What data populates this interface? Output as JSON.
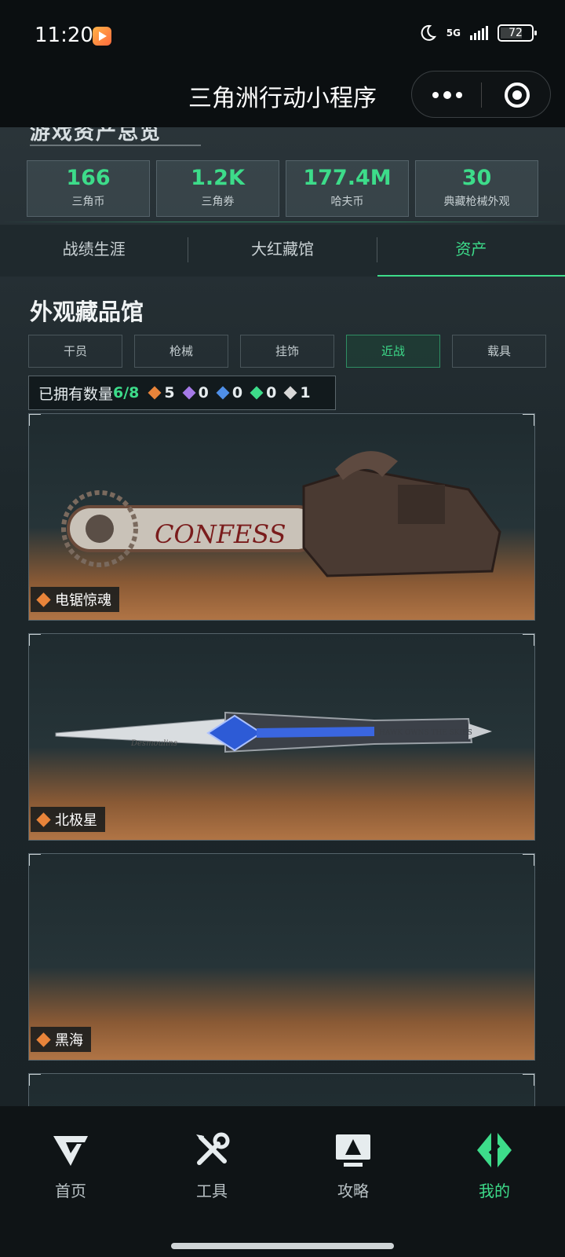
{
  "status_bar": {
    "time": "11:20",
    "network": "5G",
    "battery": "72",
    "battery_level": 72
  },
  "title_bar": {
    "title": "三角洲行动小程序"
  },
  "overview": {
    "title": "游戏资产总览",
    "stats": [
      {
        "value": "166",
        "label": "三角币"
      },
      {
        "value": "1.2K",
        "label": "三角券"
      },
      {
        "value": "177.4M",
        "label": "哈夫币"
      },
      {
        "value": "30",
        "label": "典藏枪械外观"
      }
    ]
  },
  "tabs": [
    {
      "label": "战绩生涯",
      "active": false
    },
    {
      "label": "大红藏馆",
      "active": false
    },
    {
      "label": "资产",
      "active": true
    }
  ],
  "collection": {
    "title": "外观藏品馆",
    "filters": [
      {
        "label": "干员",
        "active": false
      },
      {
        "label": "枪械",
        "active": false
      },
      {
        "label": "挂饰",
        "active": false
      },
      {
        "label": "近战",
        "active": true
      },
      {
        "label": "载具",
        "active": false
      }
    ],
    "owned_label": "已拥有数量",
    "owned_count": "6/8",
    "rarity_counts": [
      {
        "color": "#e9843a",
        "count": "5",
        "icon": "orange-gem-icon"
      },
      {
        "color": "#a57ae8",
        "count": "0",
        "icon": "purple-gem-icon"
      },
      {
        "color": "#4f8fe8",
        "count": "0",
        "icon": "blue-gem-icon"
      },
      {
        "color": "#3ddc8a",
        "count": "0",
        "icon": "green-gem-icon"
      },
      {
        "color": "#d8d8d8",
        "count": "1",
        "icon": "white-gem-icon"
      }
    ],
    "items": [
      {
        "name": "电锯惊魂",
        "art": "chainsaw-art",
        "chainsaw_text": "CONFESS"
      },
      {
        "name": "北极星",
        "art": "dagger-art",
        "dagger_text_left": "Desmoulins",
        "dagger_text_right": "HAWK OWNS THE SKIES"
      },
      {
        "name": "黑海",
        "art": "empty-art"
      }
    ]
  },
  "bottom_nav": [
    {
      "label": "首页",
      "icon": "home-logo-icon",
      "active": false
    },
    {
      "label": "工具",
      "icon": "tools-icon",
      "active": false
    },
    {
      "label": "攻略",
      "icon": "guide-icon",
      "active": false
    },
    {
      "label": "我的",
      "icon": "profile-logo-icon",
      "active": true
    }
  ],
  "colors": {
    "accent": "#3ddc8a",
    "background": "#1b2428"
  }
}
